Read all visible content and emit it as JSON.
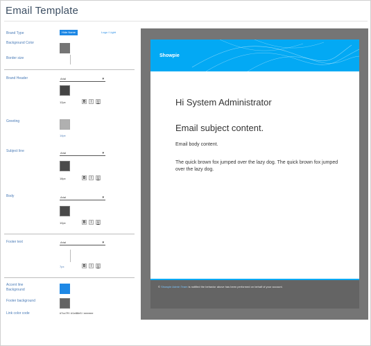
{
  "title": "Email Template",
  "brand": {
    "label": "Brand Type",
    "options": [
      "Hide Name",
      "Logo / Light"
    ],
    "color_label": "Background Color",
    "color": "#757575",
    "size_label": "Border size"
  },
  "sections": [
    {
      "label": "Brand Header",
      "dropdown": "Arial",
      "size": "12px",
      "color": "#444444"
    },
    {
      "label": "Greeting",
      "dropdown": "",
      "size": "14px",
      "color": "#b0b0b0"
    },
    {
      "label": "Subject line",
      "dropdown": "Arial",
      "size": "18px",
      "color": "#4a4a4a"
    },
    {
      "label": "Body",
      "dropdown": "Arial",
      "size": "10px",
      "color": "#4a4a4a"
    },
    {
      "label": "Footer text",
      "dropdown": "Arial",
      "size": "7px",
      "color": "#ffffff"
    }
  ],
  "footer_settings": {
    "accent_label": "Accent line",
    "accent_sub": "Background",
    "accent_color": "#03a9f4",
    "bg_label": "Footer background",
    "bg_color": "#646464",
    "link_label": "Link color code",
    "link_value": "#7cc7ff / #1e88e5 / eeeeee"
  },
  "preview": {
    "brand_text": "Showpie",
    "greeting": "Hi System Administrator",
    "subject": "Email subject content.",
    "body": "Email body content.",
    "paragraph": "The quick brown fox jumped over the lazy dog. The quick brown fox jumped over the lazy dog.",
    "footer_prefix": "© ",
    "footer_link": "Showpie Admin Team",
    "footer_text": " is notified the behavior above has been performed on behalf of your account.",
    "colors": {
      "banner": "#03a9f4",
      "footer": "#646464",
      "outer": "#757575"
    }
  }
}
